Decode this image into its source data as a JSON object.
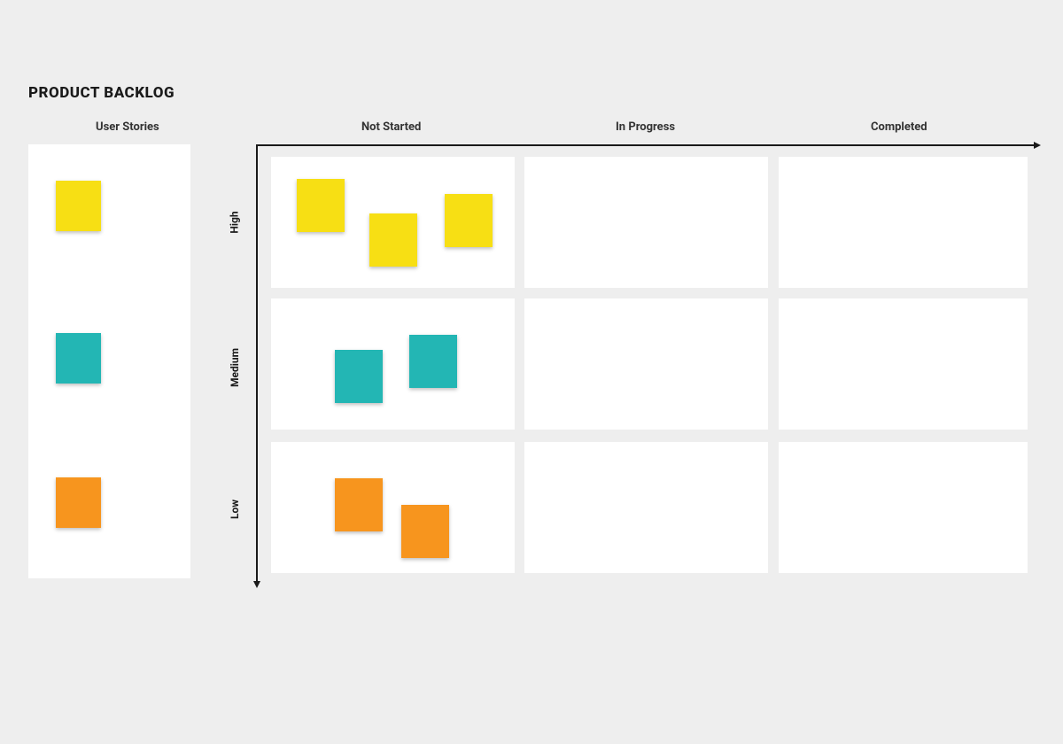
{
  "title": "PRODUCT BACKLOG",
  "columns": {
    "user_stories": "User Stories",
    "not_started": "Not Started",
    "in_progress": "In Progress",
    "completed": "Completed"
  },
  "rows": {
    "high": "High",
    "medium": "Medium",
    "low": "Low"
  },
  "colors": {
    "yellow": "#f7df14",
    "teal": "#23b6b4",
    "orange": "#f7951e",
    "white": "#ffffff",
    "bg": "#eeeeee"
  }
}
